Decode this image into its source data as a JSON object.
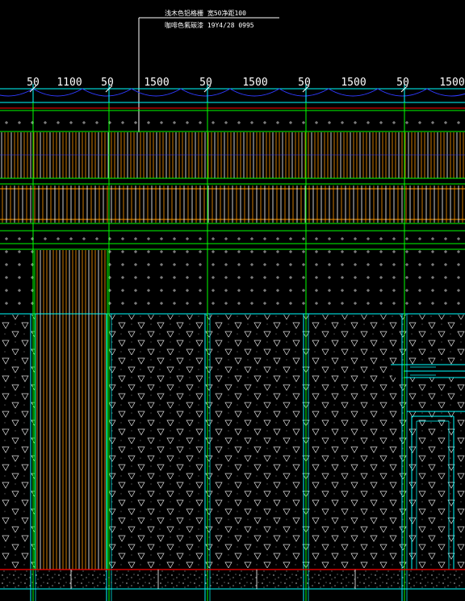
{
  "annotations": {
    "line1": "浅木色铝格栅  宽50净距100",
    "line2": "咖啡色氟碳漆  19Y4/28  0995"
  },
  "dimensions": [
    "50",
    "1100",
    "50",
    "1500",
    "50",
    "1500",
    "50",
    "1500",
    "50",
    "1500"
  ],
  "colors": {
    "background": "#000000",
    "grid_green": "#00ff00",
    "cyan": "#00ffff",
    "slat_orange": "#ff9900",
    "slat_white": "#ffffff",
    "hatch": "#ffffff",
    "baseline_red": "#ff0000",
    "arc_blue": "#2f3bff"
  },
  "layers": [
    {
      "name": "plus-hatch-strip"
    },
    {
      "name": "aluminium-grille-band"
    },
    {
      "name": "framed-slat-band"
    },
    {
      "name": "plus-hatch-band"
    },
    {
      "name": "triangle-hatch-wall"
    },
    {
      "name": "stone-base"
    }
  ]
}
